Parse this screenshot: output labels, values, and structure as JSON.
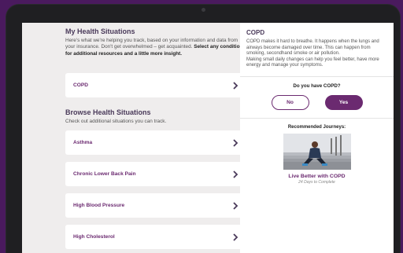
{
  "health": {
    "title": "My Health Situations",
    "description": "Here's what we're helping you track, based on your information and data from your insurance. Don't get overwhelmed – get acquainted.",
    "description_bold": "Select any condition for additional resources and a little more insight.",
    "items": [
      {
        "label": "COPD"
      }
    ]
  },
  "browse": {
    "title": "Browse Health Situations",
    "subtitle": "Check out additional situations you can track.",
    "items": [
      {
        "label": "Asthma"
      },
      {
        "label": "Chronic Lower Back Pain"
      },
      {
        "label": "High Blood Pressure"
      },
      {
        "label": "High Cholesterol"
      }
    ]
  },
  "detail": {
    "title": "COPD",
    "description": "COPD makes it hard to breathe. It happens when the lungs and airways become damaged over time. This can happen from smoking, secondhand smoke or air pollution.",
    "description2": "Making small daily changes can help you feel better, have more energy and manage your symptoms.",
    "question": "Do you have COPD?",
    "no_label": "No",
    "yes_label": "Yes",
    "recommended_label": "Recommended Journeys:",
    "journey": {
      "title": "Live Better with COPD",
      "subtitle": "24 Days to Complete"
    }
  },
  "colors": {
    "background": "#4a1a5e",
    "accent": "#6b2a70",
    "heading": "#4a3a5a"
  },
  "icons": {
    "card_chevron": "chevron-right-icon"
  }
}
